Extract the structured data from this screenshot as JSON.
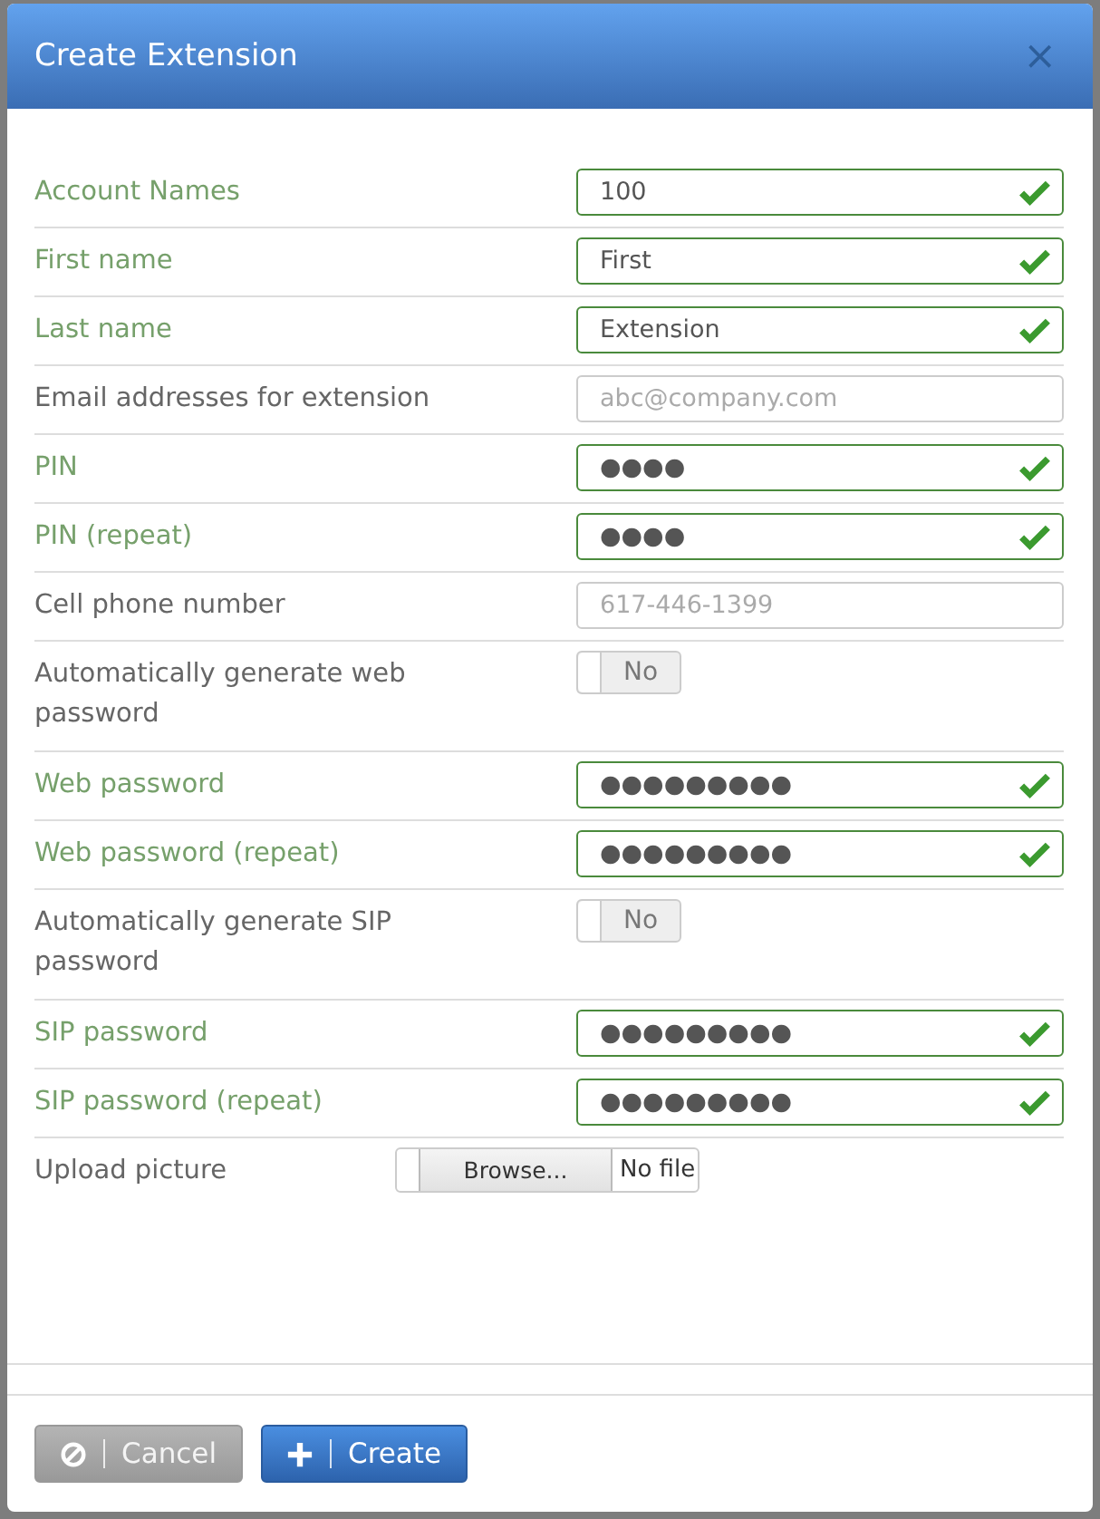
{
  "dialog": {
    "title": "Create Extension",
    "close": "×"
  },
  "fields": [
    {
      "kind": "text",
      "label": "Account Names",
      "value": "100",
      "valid": true
    },
    {
      "kind": "text",
      "label": "First name",
      "value": "First",
      "valid": true
    },
    {
      "kind": "text",
      "label": "Last name",
      "value": "Extension",
      "valid": true
    },
    {
      "kind": "text",
      "label": "Email addresses for extension",
      "placeholder": "abc@company.com",
      "valid": false
    },
    {
      "kind": "text",
      "label": "PIN",
      "value": "●●●●",
      "valid": true
    },
    {
      "kind": "text",
      "label": "PIN (repeat)",
      "value": "●●●●",
      "valid": true
    },
    {
      "kind": "text",
      "label": "Cell phone number",
      "placeholder": "617-446-1399",
      "valid": false
    },
    {
      "kind": "toggle",
      "label": "Automatically generate web password",
      "value": "No",
      "on": false
    },
    {
      "kind": "text",
      "label": "Web password",
      "value": "●●●●●●●●●",
      "valid": true
    },
    {
      "kind": "text",
      "label": "Web password (repeat)",
      "value": "●●●●●●●●●",
      "valid": true
    },
    {
      "kind": "toggle",
      "label": "Automatically generate SIP password",
      "value": "No",
      "on": false
    },
    {
      "kind": "text",
      "label": "SIP password",
      "value": "●●●●●●●●●",
      "valid": true
    },
    {
      "kind": "text",
      "label": "SIP password (repeat)",
      "value": "●●●●●●●●●",
      "valid": true
    },
    {
      "kind": "file",
      "label": "Upload picture",
      "button": "Browse...",
      "value": "No file"
    }
  ],
  "buttons": [
    {
      "kind": "cancel",
      "label": "Cancel"
    },
    {
      "kind": "create",
      "label": "Create"
    }
  ]
}
